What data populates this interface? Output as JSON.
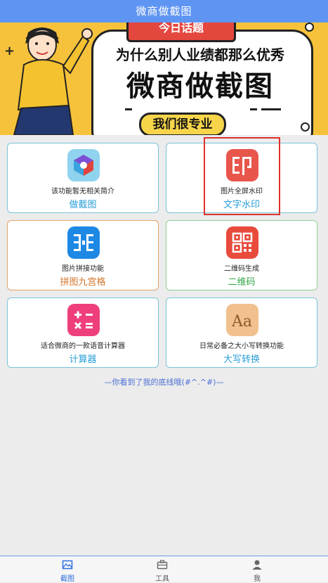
{
  "app": {
    "title": "微商做截图"
  },
  "banner": {
    "tag": "今日话题",
    "headline": "为什么别人业绩都那么优秀",
    "title": "微商做截图",
    "pill": "我们很专业"
  },
  "tools": [
    {
      "desc": "该功能暂无相关简介",
      "name": "做截图",
      "name_color": "#2a9fd8",
      "icon": "cube-logo-icon"
    },
    {
      "desc": "图片全屏水印",
      "name": "文字水印",
      "name_color": "#2a9fd8",
      "icon": "watermark-icon"
    },
    {
      "desc": "图片拼接功能",
      "name": "拼图九宫格",
      "name_color": "#d2752a",
      "icon": "collage-icon"
    },
    {
      "desc": "二维码生成",
      "name": "二维码",
      "name_color": "#33a548",
      "icon": "qrcode-icon"
    },
    {
      "desc": "适合微商的一款语音计算器",
      "name": "计算器",
      "name_color": "#2a9fd8",
      "icon": "calculator-icon"
    },
    {
      "desc": "日常必备之大小写转换功能",
      "name": "大写转换",
      "name_color": "#2a9fd8",
      "icon": "case-convert-icon"
    }
  ],
  "footer_text": "—你看到了我的底线哦(#^.^#)—",
  "tabbar": {
    "items": [
      {
        "label": "截图",
        "active": true,
        "icon": "image-icon"
      },
      {
        "label": "工具",
        "active": false,
        "icon": "toolbox-icon"
      },
      {
        "label": "我",
        "active": false,
        "icon": "user-icon"
      }
    ],
    "active_color": "#2f6fe0"
  }
}
